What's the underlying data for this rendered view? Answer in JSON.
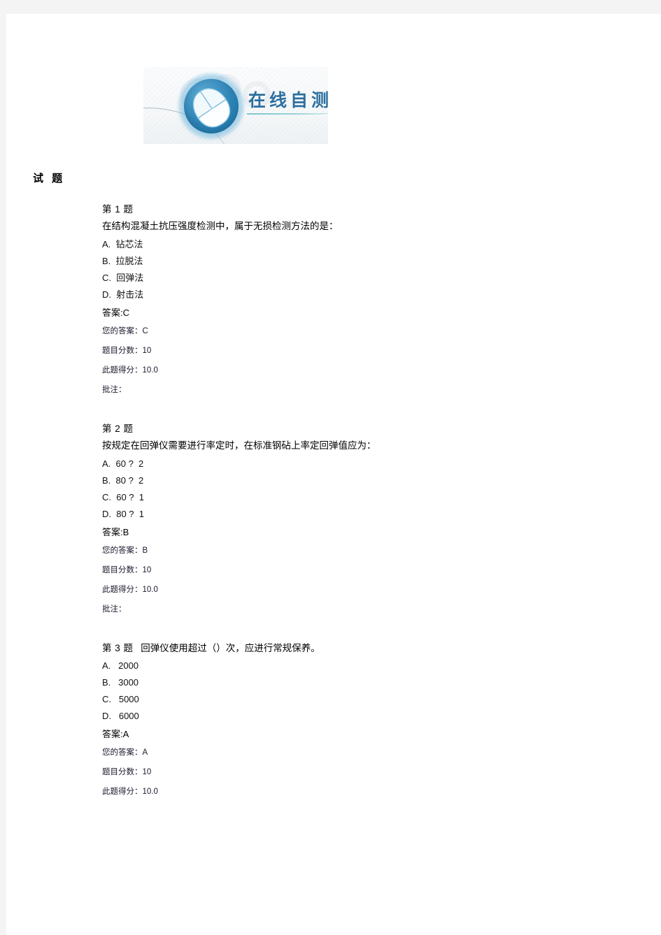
{
  "banner": {
    "title": "在线自测",
    "logo_icon": "computer-mouse-icon",
    "accent_color": "#2b6f9e",
    "disc_color": "#2e84b6",
    "rule_color": "#7ec4cf"
  },
  "page": {
    "title": "试 题",
    "background_color": "#ffffff",
    "margin_band_color": "#f4f4f4"
  },
  "labels": {
    "answer_prefix": "答案:",
    "your_answer": "您的答案：",
    "question_score": "题目分数：",
    "earned_score": "此题得分：",
    "remark": "批注："
  },
  "questions": [
    {
      "number_label": "第 1 题",
      "inline_stem": "",
      "stem": "在结构混凝土抗压强度检测中，属于无损检测方法的是：",
      "options": [
        "A.  钻芯法",
        "B.  拉脱法",
        "C.  回弹法",
        "D.  射击法"
      ],
      "answer": "答案:C",
      "your_answer": "您的答案：C",
      "question_score": "题目分数：10",
      "earned_score": "此题得分：10.0",
      "remark": "批注："
    },
    {
      "number_label": "第 2 题",
      "inline_stem": "",
      "stem": "按规定在回弹仪需要进行率定时，在标准钢砧上率定回弹值应为：",
      "options": [
        "A.  60 ?  2",
        "B.  80 ?  2",
        "C.  60 ?  1",
        "D.  80 ?  1"
      ],
      "answer": "答案:B",
      "your_answer": "您的答案：B",
      "question_score": "题目分数：10",
      "earned_score": "此题得分：10.0",
      "remark": "批注："
    },
    {
      "number_label": "第 3 题",
      "inline_stem": "回弹仪使用超过（）次，应进行常规保养。",
      "stem": "",
      "options": [
        "A.   2000",
        "B.   3000",
        "C.   5000",
        "D.   6000"
      ],
      "answer": "答案:A",
      "your_answer": "您的答案：A",
      "question_score": "题目分数：10",
      "earned_score": "此题得分：10.0",
      "remark": ""
    }
  ]
}
